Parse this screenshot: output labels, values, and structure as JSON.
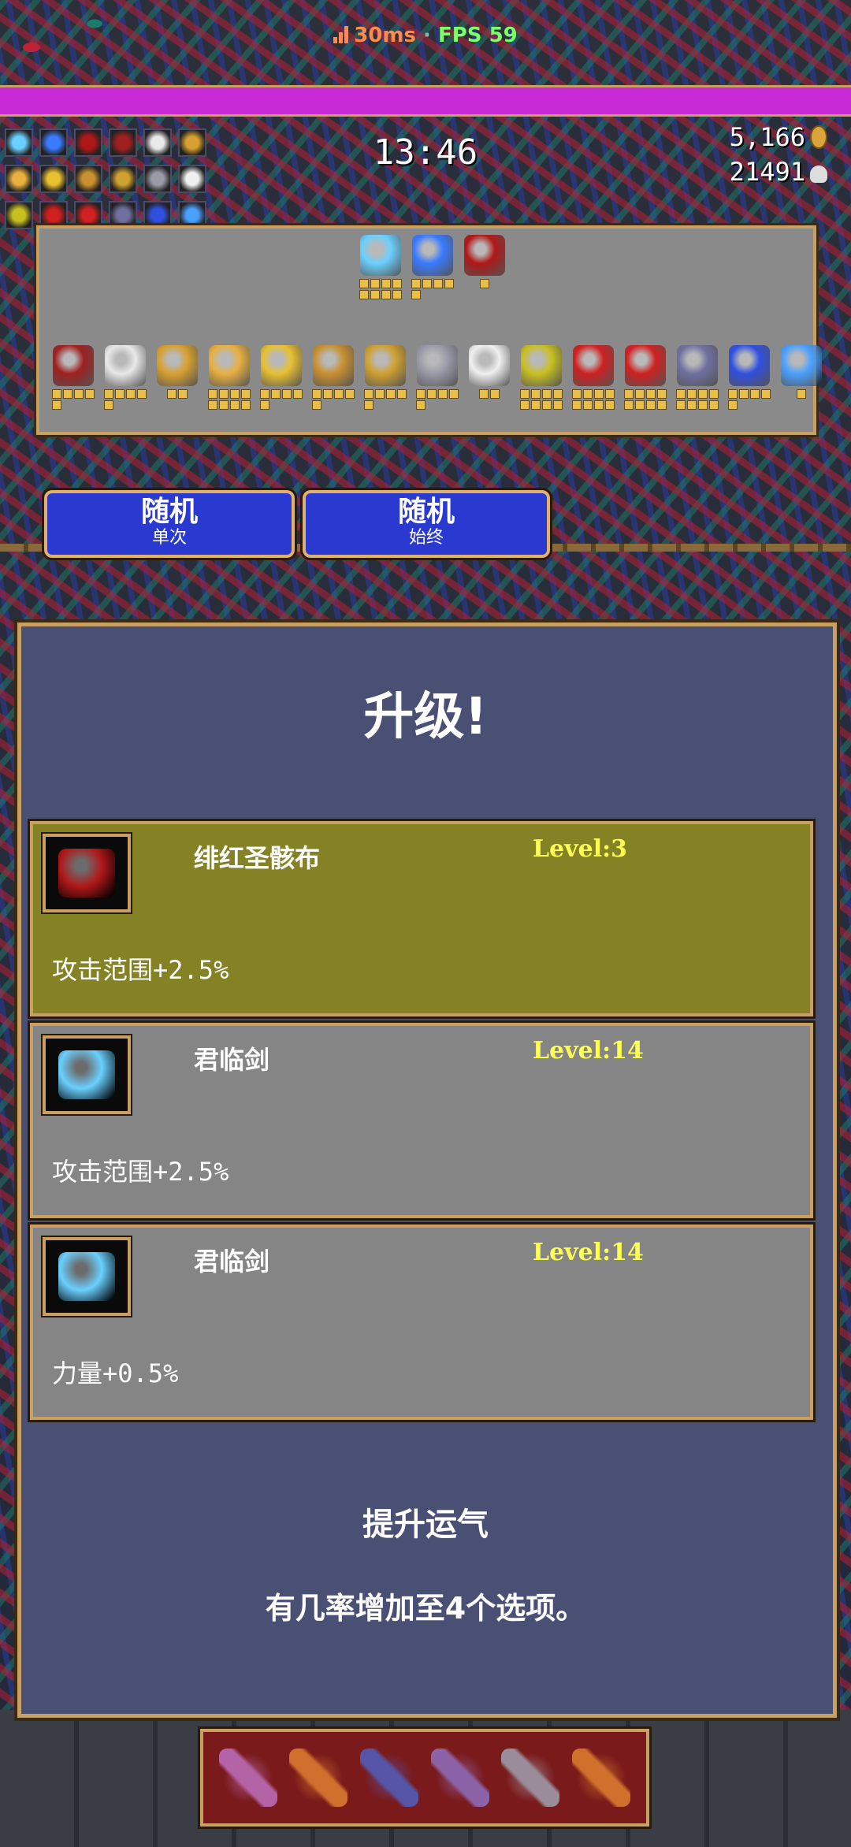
{
  "hud": {
    "ping": "30ms",
    "separator": "·",
    "fps": "FPS 59",
    "timer": "13:46",
    "gold": "5,166",
    "kills": "21491",
    "xp_progress": 1.0
  },
  "inventory": {
    "weapons": [
      {
        "icon": "heaven-sword-icon",
        "color": "#6ad0ff",
        "level": 8
      },
      {
        "icon": "dagger-icon",
        "color": "#3a7aff",
        "level": 5
      },
      {
        "icon": "crimson-shroud-icon",
        "color": "#b01818",
        "level": 1
      }
    ],
    "passives": [
      {
        "icon": "tome-icon",
        "color": "#a02020",
        "level": 5
      },
      {
        "icon": "skull-icon",
        "color": "#e8e8e8",
        "level": 5
      },
      {
        "icon": "ring-icon",
        "color": "#d8a030",
        "level": 2
      },
      {
        "icon": "candle-icon",
        "color": "#e8b040",
        "level": 8
      },
      {
        "icon": "crown-icon",
        "color": "#e8c030",
        "level": 5
      },
      {
        "icon": "lantern-icon",
        "color": "#c89030",
        "level": 5
      },
      {
        "icon": "candelabra-icon",
        "color": "#d0a030",
        "level": 5
      },
      {
        "icon": "armor-icon",
        "color": "#9a9aa8",
        "level": 5
      },
      {
        "icon": "wings-icon",
        "color": "#f0f0f0",
        "level": 2
      },
      {
        "icon": "gold-ring-icon",
        "color": "#c8c020",
        "level": 8
      },
      {
        "icon": "spellbinder-icon",
        "color": "#d02020",
        "level": 8
      },
      {
        "icon": "spellbinder-left-icon",
        "color": "#d02020",
        "level": 8
      },
      {
        "icon": "silver-ring-icon",
        "color": "#7070a0",
        "level": 8
      },
      {
        "icon": "orb-icon",
        "color": "#3050e0",
        "level": 5
      },
      {
        "icon": "sigma-icon",
        "color": "#4aa0ff",
        "level": 1
      }
    ]
  },
  "buttons": {
    "random_once": {
      "big": "随机",
      "small": "单次"
    },
    "random_always": {
      "big": "随机",
      "small": "始终"
    }
  },
  "levelup": {
    "title": "升级!",
    "options": [
      {
        "name": "绯红圣骸布",
        "level": "Level:3",
        "desc": "攻击范围+2.5%",
        "icon": "crimson-shroud-icon",
        "selected": true
      },
      {
        "name": "君临剑",
        "level": "Level:14",
        "desc": "攻击范围+2.5%",
        "icon": "heaven-sword-icon",
        "selected": false
      },
      {
        "name": "君临剑",
        "level": "Level:14",
        "desc": "力量+0.5%",
        "icon": "heaven-sword-icon",
        "selected": false
      }
    ],
    "luck_title": "提升运气",
    "luck_desc": "有几率增加至4个选项。"
  },
  "weapon_bar": [
    {
      "icon": "crossed-swords-icon",
      "color": "#c070c0"
    },
    {
      "icon": "whip-icon",
      "color": "#e08030"
    },
    {
      "icon": "pickaxe-icon",
      "color": "#5060c0"
    },
    {
      "icon": "potion-icon",
      "color": "#9070c0"
    },
    {
      "icon": "axe-icon",
      "color": "#a0a0b0"
    },
    {
      "icon": "fire-wand-icon",
      "color": "#e08030"
    }
  ]
}
